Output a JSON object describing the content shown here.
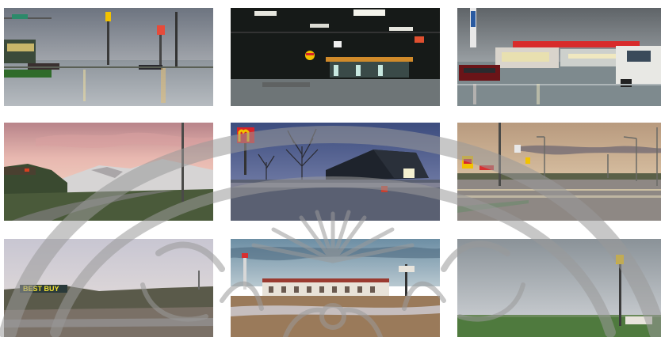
{
  "gallery": {
    "tiles": [
      {
        "row": 1,
        "col": 1,
        "scene": "gas-station-rainy-dusk"
      },
      {
        "row": 1,
        "col": 2,
        "scene": "gas-station-night"
      },
      {
        "row": 1,
        "col": 3,
        "scene": "gas-station-wet-pavement-truck"
      },
      {
        "row": 2,
        "col": 1,
        "scene": "pink-sky-hills-road"
      },
      {
        "row": 2,
        "col": 2,
        "scene": "mcdonalds-sign-dusk"
      },
      {
        "row": 2,
        "col": 3,
        "scene": "highway-dusk-streetlights"
      },
      {
        "row": 3,
        "col": 1,
        "scene": "best-buy-hill",
        "sign_text": "BEST BUY"
      },
      {
        "row": 3,
        "col": 2,
        "scene": "motel-row-field"
      },
      {
        "row": 3,
        "col": 3,
        "scene": "green-field-sign-pole"
      }
    ]
  },
  "colors": {
    "watermark": "#9a9a9a",
    "mcdonalds_yellow": "#f2c200",
    "shell_red": "#d8232a"
  }
}
